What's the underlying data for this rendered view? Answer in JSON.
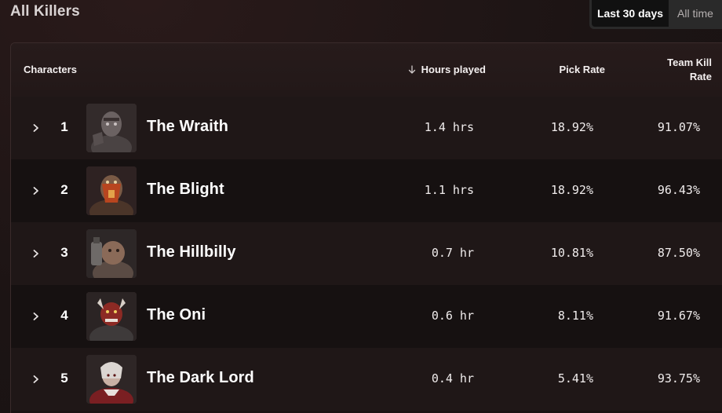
{
  "title": "All Killers",
  "time_range": {
    "options": [
      "Last 30 days",
      "All time"
    ],
    "selected": "Last 30 days"
  },
  "table": {
    "columns": {
      "characters": "Characters",
      "hours": "Hours played",
      "pick_rate": "Pick Rate",
      "kill_rate": "Team Kill Rate"
    },
    "sort": {
      "column": "hours",
      "direction": "descending",
      "icon": "arrow-down-icon"
    },
    "rows": [
      {
        "rank": "1",
        "name": "The Wraith",
        "hours": "1.4 hrs",
        "pick_rate": "18.92%",
        "kill_rate": "91.07%"
      },
      {
        "rank": "2",
        "name": "The Blight",
        "hours": "1.1 hrs",
        "pick_rate": "18.92%",
        "kill_rate": "96.43%"
      },
      {
        "rank": "3",
        "name": "The Hillbilly",
        "hours": "0.7 hr",
        "pick_rate": "10.81%",
        "kill_rate": "87.50%"
      },
      {
        "rank": "4",
        "name": "The Oni",
        "hours": "0.6 hr",
        "pick_rate": "8.11%",
        "kill_rate": "91.67%"
      },
      {
        "rank": "5",
        "name": "The Dark Lord",
        "hours": "0.4 hr",
        "pick_rate": "5.41%",
        "kill_rate": "93.75%"
      }
    ]
  }
}
